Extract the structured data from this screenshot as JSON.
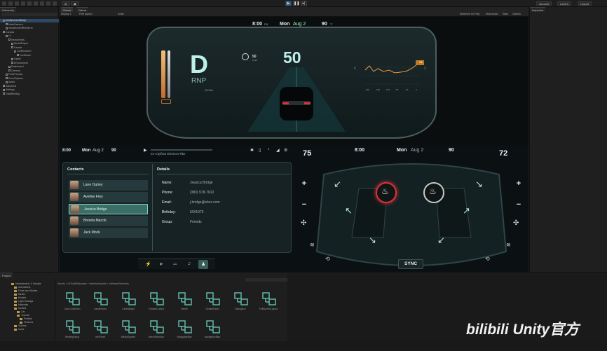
{
  "editor": {
    "menus": [
      "Default",
      "Account",
      "Layout"
    ],
    "top_tabs": [
      "Scene",
      "Game"
    ],
    "hierarchy_title": "Hierarchy",
    "inspector_title": "Inspector",
    "game_toolbar": [
      "Display 1",
      "Free Aspect",
      "Scale",
      "Maximize On Play",
      "Mute Audio",
      "Stats",
      "Gizmos"
    ],
    "hierarchy_rows": [
      "InfotainmentSetup",
      "MainCamera",
      "InfotainmentRenderer",
      "Canvas",
      "UI",
      "Instruments",
      "MediaPlayer",
      "Cluster",
      "CarRenderer",
      "CarModel",
      "Lights",
      "Environment",
      "Dashboard",
      "Camera",
      "PostProcess",
      "EventSystem",
      "Audio",
      "SafeArea",
      "Settings",
      "DataBinding"
    ]
  },
  "cluster": {
    "time": "8:00",
    "time_suffix": "PM",
    "date": "Mon",
    "date2": "Aug 2",
    "temp": "90",
    "temp_unit": "°F",
    "gear": "D",
    "gear_modes": "RNP",
    "speed": "50",
    "limit": "50",
    "limit_unit": "Km/h",
    "range_label": "Chr/Dst",
    "graph_badge": "71",
    "graph_axis": [
      "-300",
      "-150",
      "-125",
      "-60",
      "-30",
      "0"
    ]
  },
  "info": {
    "time": "8:00",
    "date": "Mon",
    "date2": "Aug 2",
    "temp": "90",
    "track": "01-Cityflow Electron-Rbz",
    "contacts_title": "Contacts",
    "details_title": "Details",
    "contacts": [
      "Lane Outrey",
      "Aveline Frey",
      "Jessica Bridge",
      "Brenda Marchi",
      "Jack Mock"
    ],
    "detail_labels": [
      "Name:",
      "Phone:",
      "Email:",
      "Birthday:",
      "Group:"
    ],
    "detail_values": [
      "Jessica Bridge",
      "(383) 978-7610",
      "j.bridge@sbcz.com",
      "5/9/1975",
      "Friends"
    ]
  },
  "seat": {
    "temp_left": "75",
    "temp_right": "72",
    "time": "8:00",
    "date": "Mon",
    "date2": "Aug 2",
    "temp": "90",
    "sync": "SYNC",
    "plus": "+",
    "minus": "−"
  },
  "project": {
    "title": "Project",
    "breadcrumb": "Assets > UIToolkitSamples > InterfaceAssets > InterfaceElements",
    "folders": [
      "Infotainment UI Sample",
      "Animations",
      "Fonts and Sprites",
      "Media",
      "Models",
      "Light Settings",
      "Materials",
      "Models",
      "Car",
      "Tutorial",
      "Prefabs",
      "Textures",
      "Scenes",
      "Icons"
    ],
    "assets": [
      "Cars Collection",
      "CarsReview",
      "CarsWidget",
      "ClimateControl",
      "Delete",
      "DetailsPanel",
      "DialogBox",
      "FullScreenLayout",
      "HeatingSetup",
      "InfoPanel",
      "MediaSystem",
      "MenuSelection",
      "NavigationBar",
      "NavigationMap"
    ]
  },
  "watermark": "bilibili Unity官方",
  "colors": {
    "accent": "#7fd8c6",
    "warning": "#e07a3a",
    "seat_hot": "#d8333a"
  }
}
